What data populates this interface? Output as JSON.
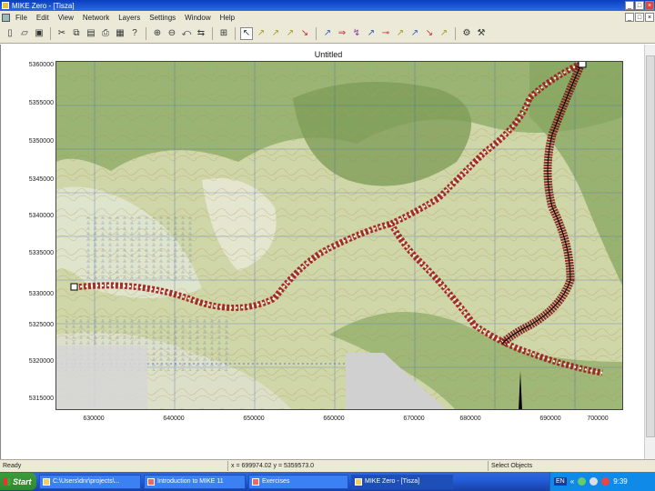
{
  "window": {
    "title": "MIKE Zero - [Tisza]",
    "min": "_",
    "max": "□",
    "close": "×"
  },
  "menu": [
    "File",
    "Edit",
    "View",
    "Network",
    "Layers",
    "Settings",
    "Window",
    "Help"
  ],
  "toolbar": {
    "buttons": [
      "new-icon",
      "open-icon",
      "save-icon",
      "cut-icon",
      "copy-icon",
      "paste-icon",
      "print-icon",
      "preview-icon",
      "help-icon",
      "zoom-in-icon",
      "zoom-out-icon",
      "zoom-previous-icon",
      "pan-icon",
      "full-extent-icon",
      "select-icon",
      "edit-point-icon",
      "add-point-icon",
      "move-point-icon",
      "delete-point-icon",
      "draw-branch-icon",
      "connect-branch-icon",
      "split-branch-icon",
      "cross-section-icon",
      "boundary-icon",
      "structure-icon",
      "weir-icon",
      "culvert-icon",
      "table-icon",
      "properties-icon"
    ]
  },
  "map": {
    "title": "Untitled",
    "y_ticks": [
      "5360000",
      "5355000",
      "5350000",
      "5345000",
      "5340000",
      "5335000",
      "5330000",
      "5325000",
      "5320000",
      "5315000"
    ],
    "x_ticks": [
      "630000",
      "640000",
      "650000",
      "660000",
      "670000",
      "680000",
      "690000",
      "700000"
    ]
  },
  "status": {
    "ready": "Ready",
    "coords": "x = 699974.02  y = 5359573.0",
    "mode": "Select Objects"
  },
  "taskbar": {
    "start": "Start",
    "tasks": [
      {
        "label": "C:\\Users\\dnr\\projects\\...",
        "active": false
      },
      {
        "label": "Introduction to MIKE 11",
        "active": false
      },
      {
        "label": "Exercises",
        "active": false
      },
      {
        "label": "MIKE Zero - [Tisza]",
        "active": true
      }
    ],
    "lang": "EN",
    "clock": "9:39"
  }
}
